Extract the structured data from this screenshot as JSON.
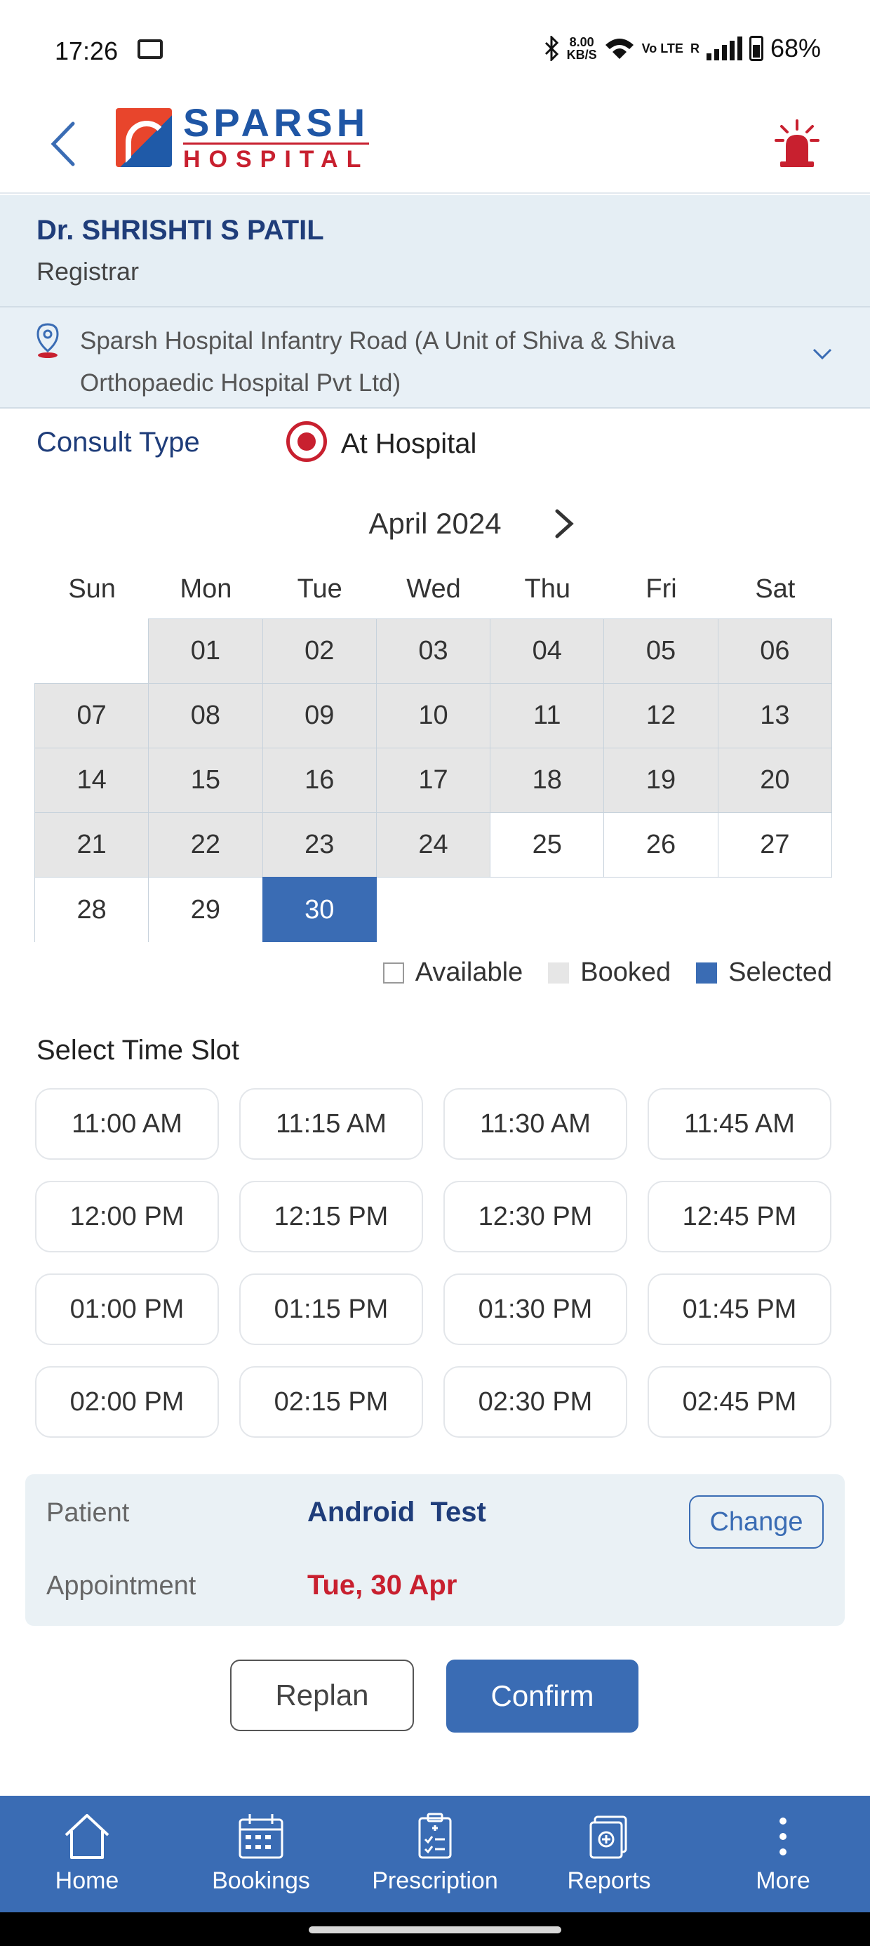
{
  "status_bar": {
    "time": "17:26",
    "net_speed_top": "8.00",
    "net_speed_bottom": "KB/S",
    "volte": "Vo LTE",
    "roaming": "R",
    "battery": "68%"
  },
  "header": {
    "logo_line1": "SPARSH",
    "logo_line2": "HOSPITAL"
  },
  "doctor": {
    "name": "Dr. SHRISHTI S PATIL",
    "role": "Registrar"
  },
  "location": {
    "text": "Sparsh Hospital Infantry Road (A Unit of Shiva & Shiva Orthopaedic Hospital Pvt Ltd)"
  },
  "consult": {
    "label": "Consult Type",
    "option": "At Hospital"
  },
  "calendar": {
    "month": "April 2024",
    "weekdays": [
      "Sun",
      "Mon",
      "Tue",
      "Wed",
      "Thu",
      "Fri",
      "Sat"
    ],
    "days": [
      {
        "label": "",
        "state": "empty"
      },
      {
        "label": "01",
        "state": "booked"
      },
      {
        "label": "02",
        "state": "booked"
      },
      {
        "label": "03",
        "state": "booked"
      },
      {
        "label": "04",
        "state": "booked"
      },
      {
        "label": "05",
        "state": "booked"
      },
      {
        "label": "06",
        "state": "booked"
      },
      {
        "label": "07",
        "state": "booked"
      },
      {
        "label": "08",
        "state": "booked"
      },
      {
        "label": "09",
        "state": "booked"
      },
      {
        "label": "10",
        "state": "booked"
      },
      {
        "label": "11",
        "state": "booked"
      },
      {
        "label": "12",
        "state": "booked"
      },
      {
        "label": "13",
        "state": "booked"
      },
      {
        "label": "14",
        "state": "booked"
      },
      {
        "label": "15",
        "state": "booked"
      },
      {
        "label": "16",
        "state": "booked"
      },
      {
        "label": "17",
        "state": "booked"
      },
      {
        "label": "18",
        "state": "booked"
      },
      {
        "label": "19",
        "state": "booked"
      },
      {
        "label": "20",
        "state": "booked"
      },
      {
        "label": "21",
        "state": "booked"
      },
      {
        "label": "22",
        "state": "booked"
      },
      {
        "label": "23",
        "state": "booked"
      },
      {
        "label": "24",
        "state": "booked"
      },
      {
        "label": "25",
        "state": "available"
      },
      {
        "label": "26",
        "state": "available"
      },
      {
        "label": "27",
        "state": "available"
      },
      {
        "label": "28",
        "state": "available"
      },
      {
        "label": "29",
        "state": "available"
      },
      {
        "label": "30",
        "state": "selected"
      }
    ],
    "legend": {
      "available": "Available",
      "booked": "Booked",
      "selected": "Selected"
    }
  },
  "time_slots": {
    "title": "Select Time Slot",
    "slots": [
      "11:00 AM",
      "11:15 AM",
      "11:30 AM",
      "11:45 AM",
      "12:00 PM",
      "12:15 PM",
      "12:30 PM",
      "12:45 PM",
      "01:00 PM",
      "01:15 PM",
      "01:30 PM",
      "01:45 PM",
      "02:00 PM",
      "02:15 PM",
      "02:30 PM",
      "02:45 PM"
    ]
  },
  "summary": {
    "patient_label": "Patient",
    "patient_value": "Android  Test",
    "change_label": "Change",
    "appointment_label": "Appointment",
    "appointment_value": "Tue, 30 Apr"
  },
  "actions": {
    "replan": "Replan",
    "confirm": "Confirm"
  },
  "colors": {
    "primary": "#3a6cb4",
    "accent_red": "#c8202f",
    "booked_gray": "#e6e6e6",
    "panel_bg": "#e5eef4"
  },
  "bottom_nav": {
    "items": [
      {
        "label": "Home",
        "icon": "home-icon"
      },
      {
        "label": "Bookings",
        "icon": "calendar-icon"
      },
      {
        "label": "Prescription",
        "icon": "prescription-icon"
      },
      {
        "label": "Reports",
        "icon": "reports-icon"
      },
      {
        "label": "More",
        "icon": "more-vertical-icon"
      }
    ]
  }
}
